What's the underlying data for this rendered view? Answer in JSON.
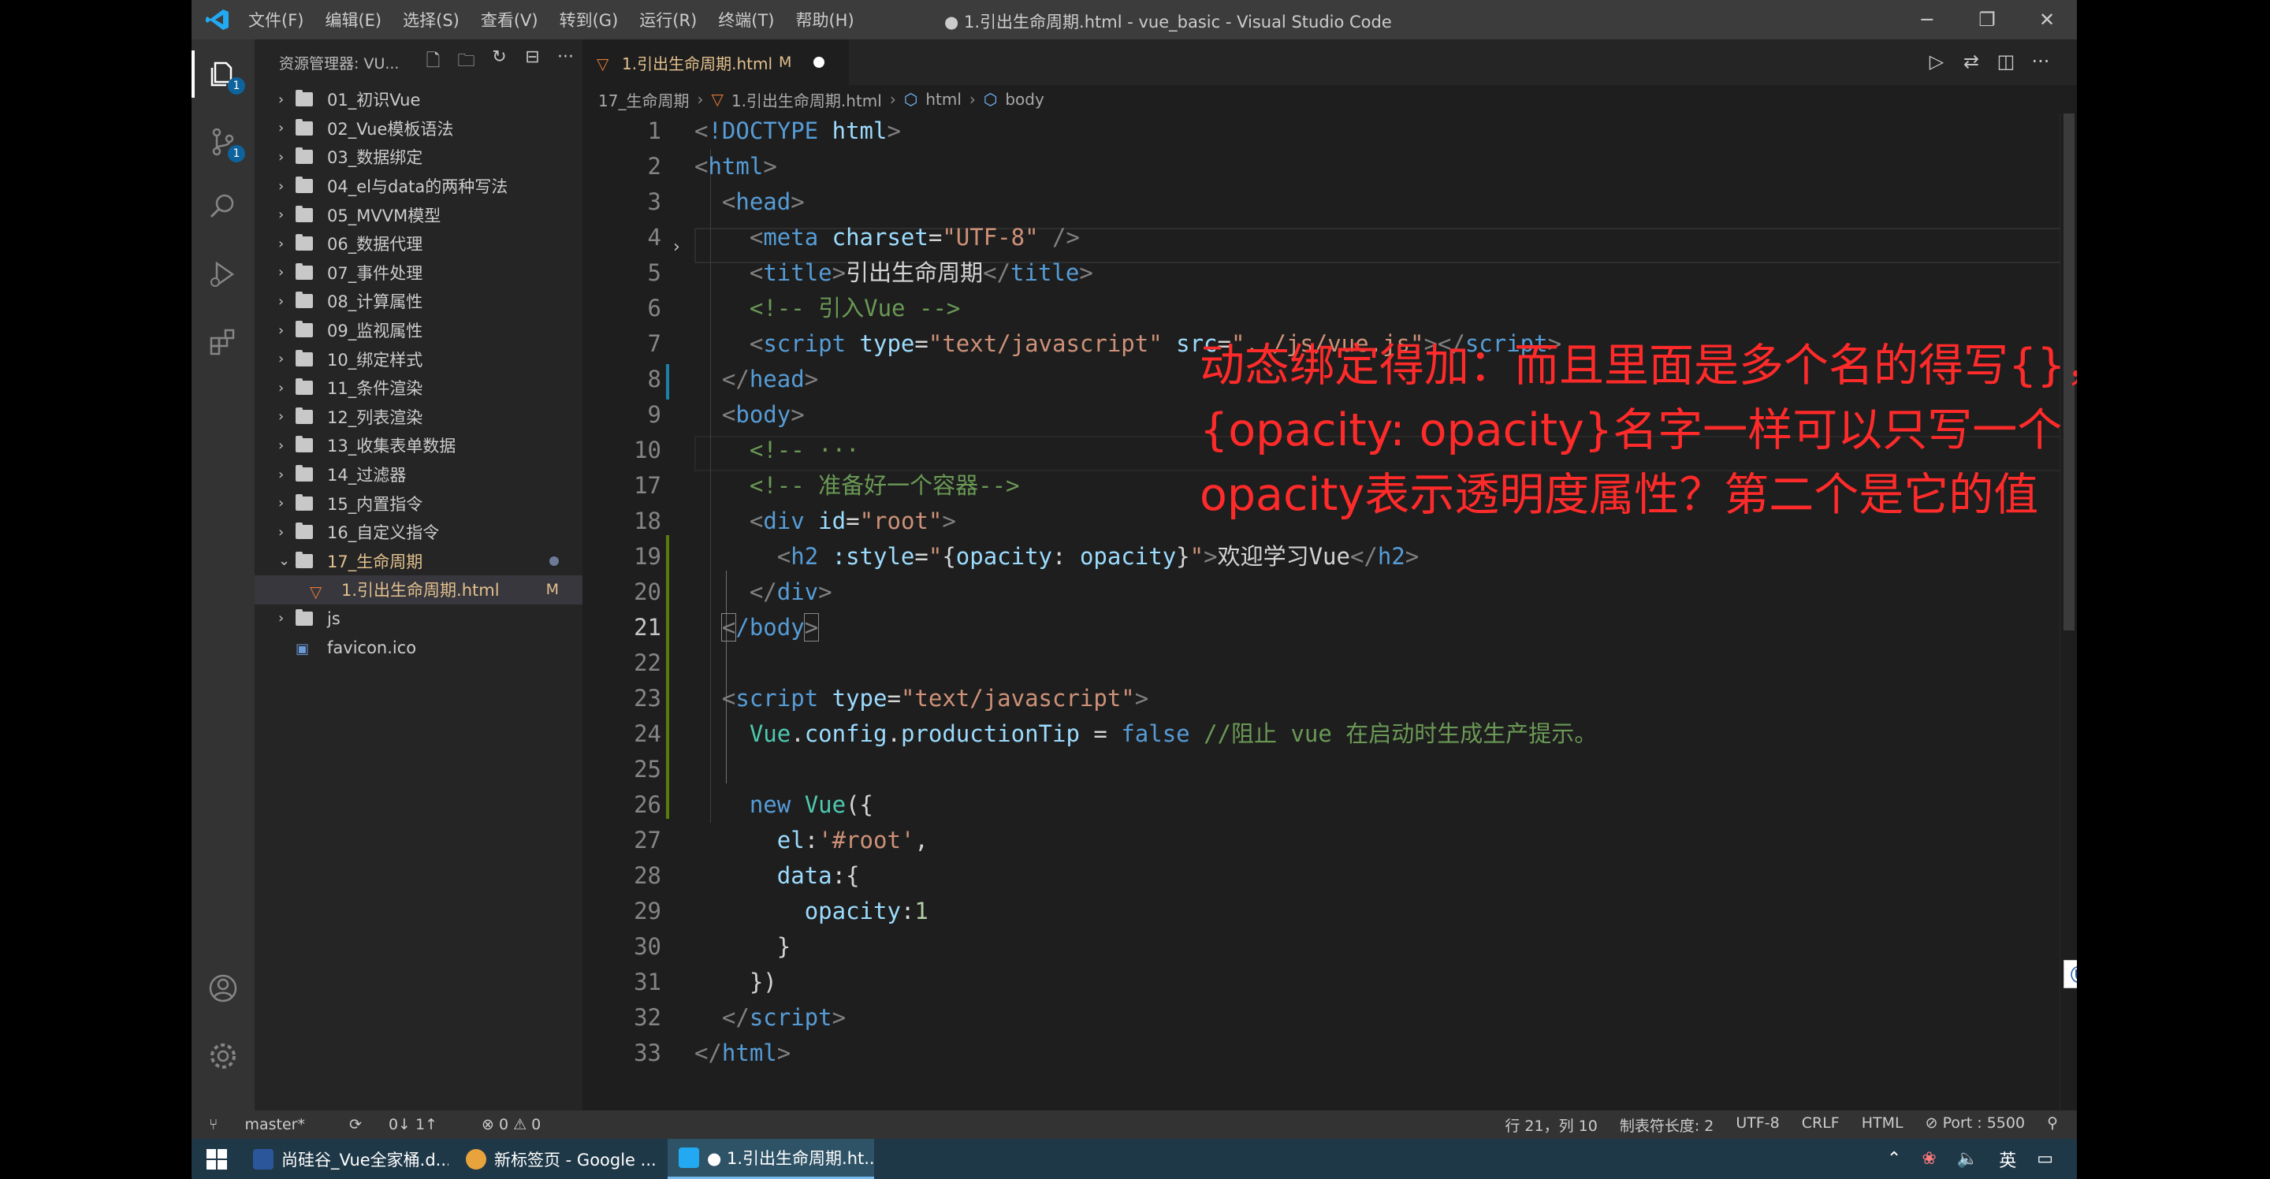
{
  "window": {
    "menu": [
      "文件(F)",
      "编辑(E)",
      "选择(S)",
      "查看(V)",
      "转到(G)",
      "运行(R)",
      "终端(T)",
      "帮助(H)"
    ],
    "title": "● 1.引出生命周期.html - vue_basic - Visual Studio Code",
    "min": "─",
    "restore": "❐",
    "close": "✕"
  },
  "activity": {
    "explorer_badge": "1",
    "scm_badge": "1"
  },
  "sidebar": {
    "title": "资源管理器: VU...",
    "items": [
      {
        "label": "01_初识Vue"
      },
      {
        "label": "02_Vue模板语法"
      },
      {
        "label": "03_数据绑定"
      },
      {
        "label": "04_el与data的两种写法"
      },
      {
        "label": "05_MVVM模型"
      },
      {
        "label": "06_数据代理"
      },
      {
        "label": "07_事件处理"
      },
      {
        "label": "08_计算属性"
      },
      {
        "label": "09_监视属性"
      },
      {
        "label": "10_绑定样式"
      },
      {
        "label": "11_条件渲染"
      },
      {
        "label": "12_列表渲染"
      },
      {
        "label": "13_收集表单数据"
      },
      {
        "label": "14_过滤器"
      },
      {
        "label": "15_内置指令"
      },
      {
        "label": "16_自定义指令"
      },
      {
        "label": "17_生命周期"
      },
      {
        "label": "1.引出生命周期.html",
        "badge": "M"
      },
      {
        "label": "js"
      },
      {
        "label": "favicon.ico"
      }
    ]
  },
  "editor": {
    "tab": {
      "name": "1.引出生命周期.html",
      "badge": "M"
    },
    "breadcrumb": [
      "17_生命周期",
      "1.引出生命周期.html",
      "html",
      "body"
    ],
    "line_numbers": [
      "1",
      "2",
      "3",
      "4",
      "5",
      "6",
      "7",
      "8",
      "9",
      "10",
      "17",
      "18",
      "19",
      "20",
      "21",
      "22",
      "23",
      "24",
      "25",
      "26",
      "27",
      "28",
      "29",
      "30",
      "31",
      "32",
      "33"
    ],
    "current_line": "21"
  },
  "annotation": {
    "line1": "动态绑定得加：而且里面是多个名的得写{}，",
    "line2": "{opacity: opacity}名字一样可以只写一个（第一个",
    "line3": "opacity表示透明度属性？第二个是它的值"
  },
  "ime": {
    "lang": "英"
  },
  "status": {
    "branch": "master*",
    "sync": "0↓ 1↑",
    "problems": "⊗ 0 ⚠ 0",
    "position": "行 21，列 10",
    "tab_size": "制表符长度: 2",
    "encoding": "UTF-8",
    "eol": "CRLF",
    "language": "HTML",
    "port": "⊘ Port : 5500"
  },
  "taskbar": {
    "items": [
      {
        "label": "尚硅谷_Vue全家桶.d...",
        "color": "#2b579a"
      },
      {
        "label": "新标签页 - Google ...",
        "color": "#e8a33d"
      },
      {
        "label": "● 1.引出生命周期.ht...",
        "color": "#23a9f2"
      }
    ],
    "ime": "英"
  }
}
